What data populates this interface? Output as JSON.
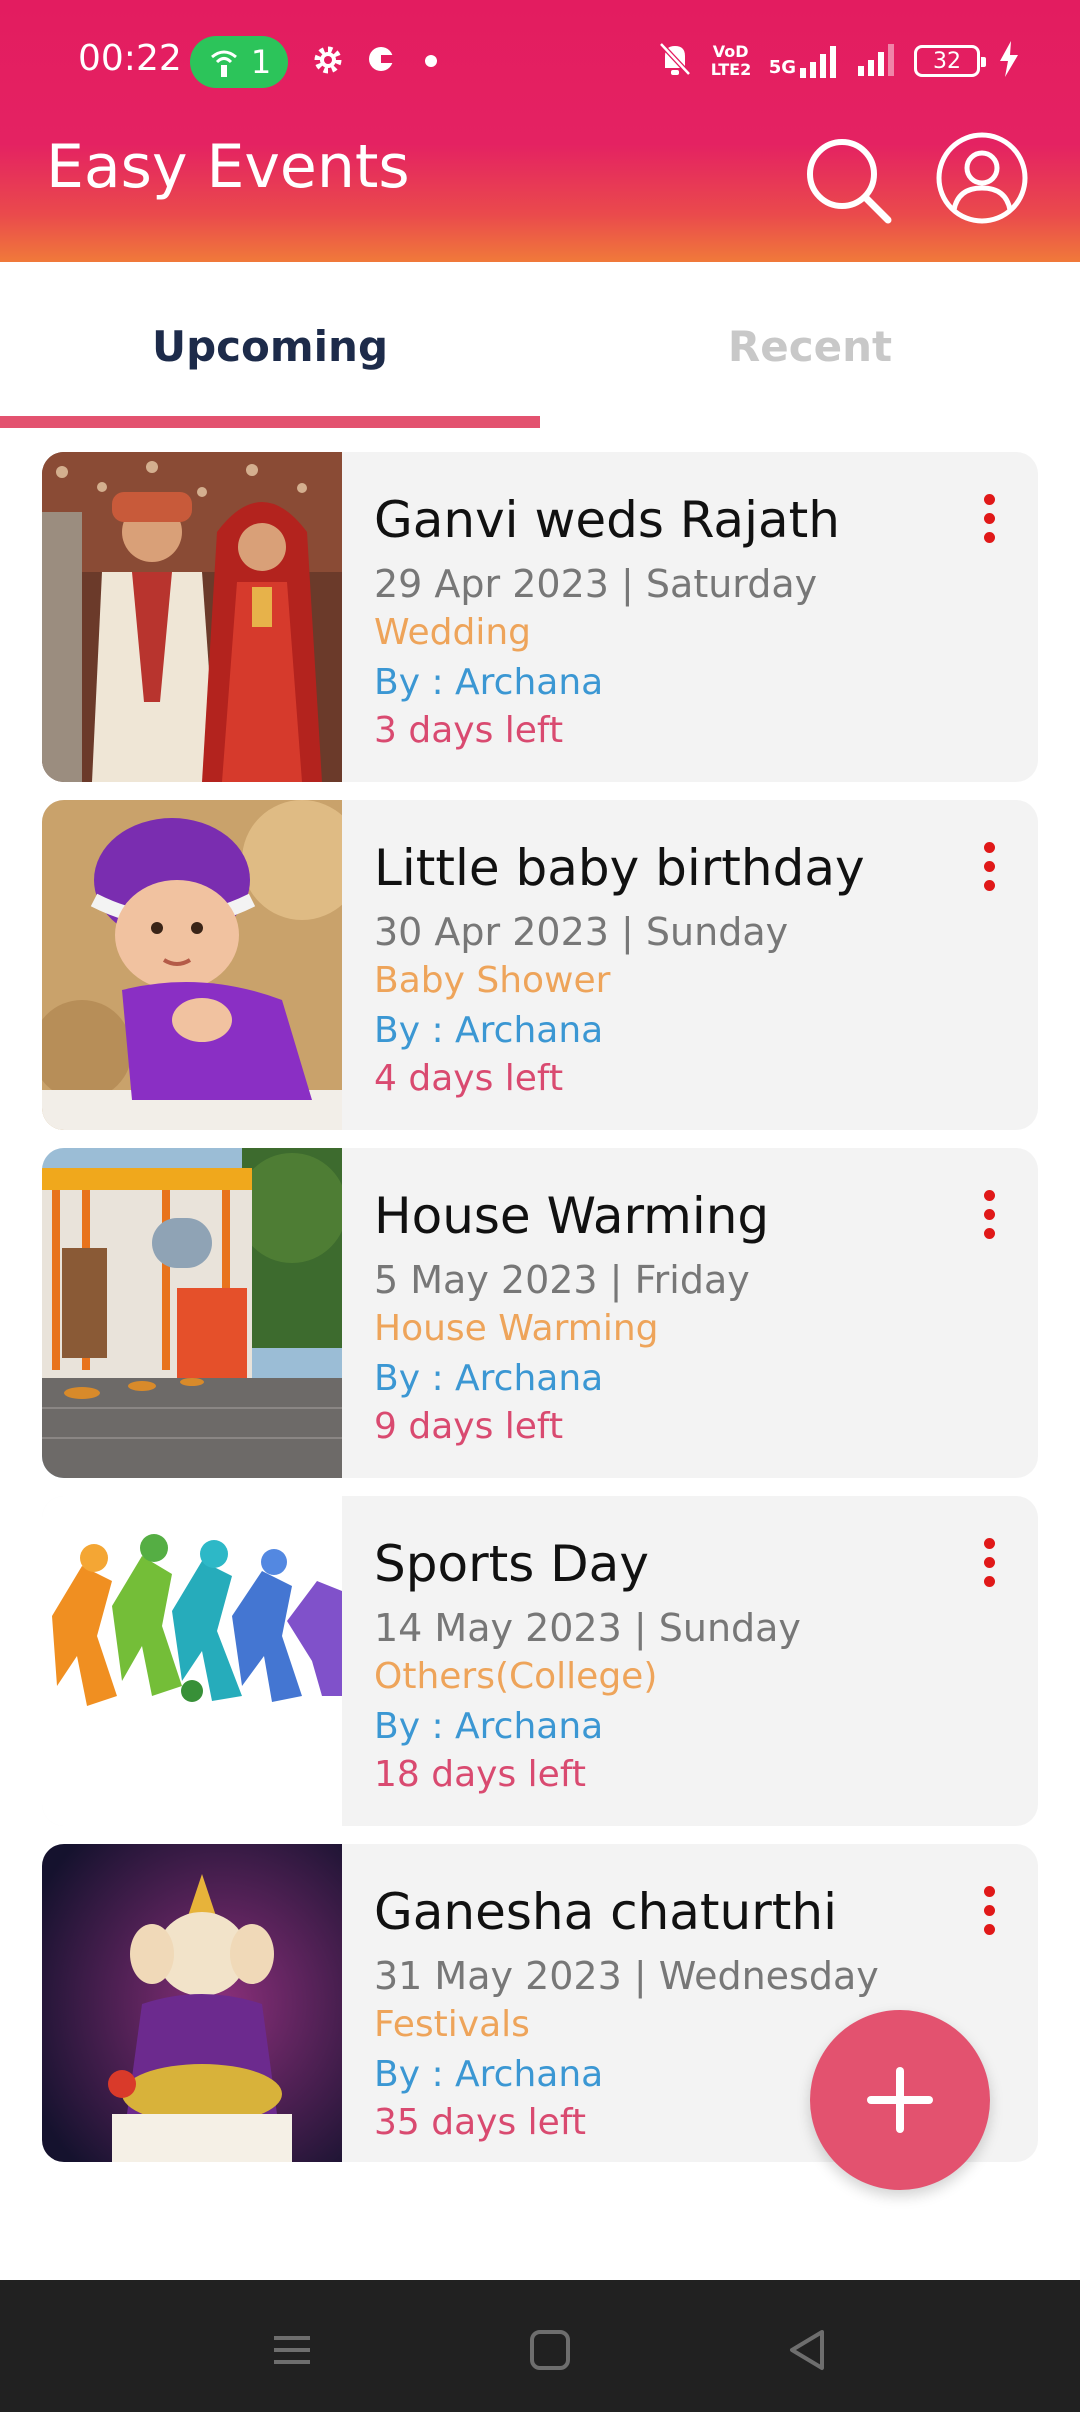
{
  "status_bar": {
    "time": "00:22",
    "hotspot_count": "1",
    "net_label_1": "VoD LTE2",
    "net_label_2": "5G",
    "battery": "32"
  },
  "header": {
    "title": "Easy Events"
  },
  "tabs": [
    {
      "label": "Upcoming",
      "active": true
    },
    {
      "label": "Recent",
      "active": false
    }
  ],
  "events": [
    {
      "title": "Ganvi weds Rajath",
      "date": "29 Apr 2023 | Saturday",
      "type": "Wedding",
      "by": "By : Archana",
      "days_left": "3 days left",
      "image": "wedding-photo"
    },
    {
      "title": "Little baby birthday",
      "date": "30 Apr 2023 | Sunday",
      "type": "Baby Shower",
      "by": "By : Archana",
      "days_left": "4 days left",
      "image": "baby-photo"
    },
    {
      "title": "House Warming",
      "date": "5 May 2023 | Friday",
      "type": "House Warming",
      "by": "By : Archana",
      "days_left": "9 days left",
      "image": "house-photo"
    },
    {
      "title": "Sports Day",
      "date": "14 May 2023 | Sunday",
      "type": "Others(College)",
      "by": "By : Archana",
      "days_left": "18 days left",
      "image": "sports-illustration"
    },
    {
      "title": "Ganesha chaturthi",
      "date": "31 May 2023 | Wednesday",
      "type": "Festivals",
      "by": "By : Archana",
      "days_left": "35 days left",
      "image": "ganesha-idol-photo"
    }
  ],
  "colors": {
    "header_start": "#e31c60",
    "header_end": "#f0793a",
    "tab_indicator": "#e3526f",
    "fab": "#e3526f",
    "event_type": "#eea45a",
    "event_by": "#3b97d3",
    "event_days_left": "#d94a70",
    "menu_dots": "#e01818"
  }
}
